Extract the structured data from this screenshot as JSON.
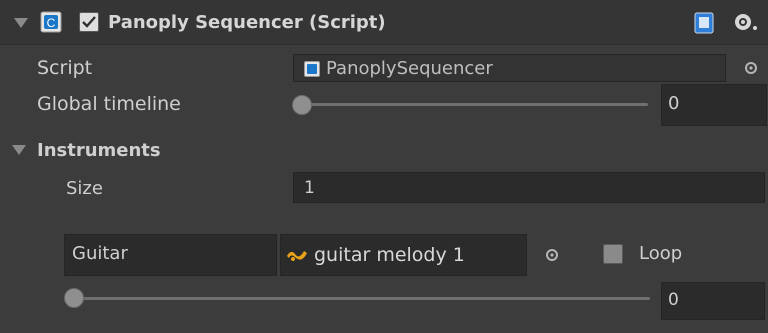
{
  "header": {
    "title": "Panoply Sequencer (Script)",
    "enabled": true
  },
  "script_field": {
    "label": "Script",
    "value": "PanoplySequencer"
  },
  "global_timeline": {
    "label": "Global timeline",
    "slider_level": 0,
    "value": "0"
  },
  "instruments": {
    "label": "Instruments",
    "size_label": "Size",
    "size_value": "1",
    "items": [
      {
        "name": "Guitar",
        "clip": "guitar melody 1",
        "loop_label": "Loop",
        "loop_checked": false,
        "slider_level": 0,
        "value": "0"
      }
    ]
  },
  "icons": {
    "header_foldout": "triangle-down-icon",
    "script_icon": "cs-script-icon",
    "enable_checkbox": "checkbox-checked-icon",
    "book": "help-book-icon",
    "gear": "gear-icon",
    "object_picker": "object-picker-icon",
    "clip_icon": "audio-clip-icon"
  }
}
